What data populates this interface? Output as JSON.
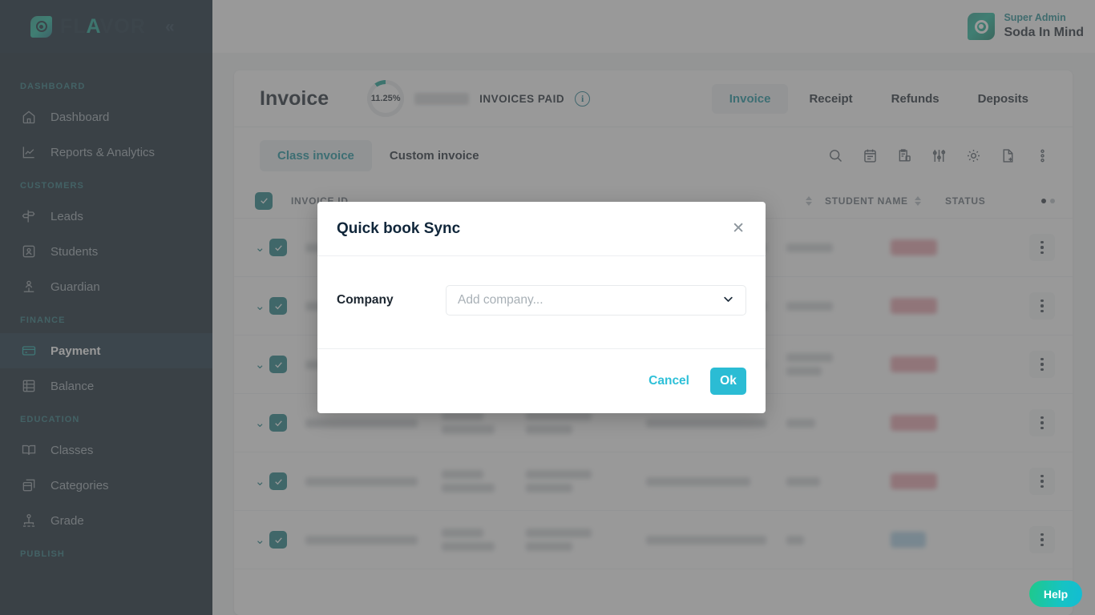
{
  "brand": {
    "logo_text_1": "FL",
    "logo_text_accent": "A",
    "logo_text_2": "VOR",
    "logo_icon": "flavor-logo-icon",
    "collapse_icon": "«",
    "accent_teal": "#11a18e",
    "accent_cyan": "#2bbcd4",
    "sidebar_bg": "#061826"
  },
  "topbar": {
    "role": "Super Admin",
    "name": "Soda In Mind"
  },
  "sidebar": {
    "sections": [
      {
        "label": "DASHBOARD",
        "items": [
          {
            "label": "Dashboard",
            "icon": "home-icon",
            "active": false
          },
          {
            "label": "Reports & Analytics",
            "icon": "chart-line-icon",
            "active": false
          }
        ]
      },
      {
        "label": "CUSTOMERS",
        "items": [
          {
            "label": "Leads",
            "icon": "signpost-icon",
            "active": false
          },
          {
            "label": "Students",
            "icon": "id-card-icon",
            "active": false
          },
          {
            "label": "Guardian",
            "icon": "guardian-icon",
            "active": false
          }
        ]
      },
      {
        "label": "FINANCE",
        "items": [
          {
            "label": "Payment",
            "icon": "credit-card-icon",
            "active": true
          },
          {
            "label": "Balance",
            "icon": "ledger-icon",
            "active": false
          }
        ]
      },
      {
        "label": "EDUCATION",
        "items": [
          {
            "label": "Classes",
            "icon": "book-open-icon",
            "active": false
          },
          {
            "label": "Categories",
            "icon": "box-stack-icon",
            "active": false
          },
          {
            "label": "Grade",
            "icon": "hierarchy-icon",
            "active": false
          }
        ]
      },
      {
        "label": "PUBLISH",
        "items": []
      }
    ]
  },
  "invoice_card": {
    "title": "Invoice",
    "paid_percent": "11.25%",
    "paid_percent_value": 11.25,
    "paid_label": "INVOICES PAID",
    "info_icon": "info-icon",
    "header_tabs": [
      {
        "label": "Invoice",
        "active": true
      },
      {
        "label": "Receipt",
        "active": false
      },
      {
        "label": "Refunds",
        "active": false
      },
      {
        "label": "Deposits",
        "active": false
      }
    ],
    "sub_tabs": [
      {
        "label": "Class invoice",
        "active": true
      },
      {
        "label": "Custom invoice",
        "active": false
      }
    ],
    "toolbar_icons": [
      "search-icon",
      "notepad-icon",
      "clipboard-export-icon",
      "sliders-filter-icon",
      "gear-icon",
      "document-add-icon",
      "more-vertical-icon"
    ],
    "table": {
      "columns": [
        {
          "label": "INVOICE ID",
          "sortable": false
        },
        {
          "label": "",
          "sortable": true
        },
        {
          "label": "STUDENT NAME",
          "sortable": true
        },
        {
          "label": "STATUS",
          "sortable": false
        }
      ],
      "header_dots": [
        "#2b343d",
        "#b9c0c6"
      ],
      "rows": [
        {
          "status_color": "red"
        },
        {
          "status_color": "red"
        },
        {
          "status_color": "red"
        },
        {
          "status_color": "red"
        },
        {
          "status_color": "red"
        },
        {
          "status_color": "blue"
        }
      ]
    }
  },
  "modal": {
    "title": "Quick book Sync",
    "close_icon": "close-icon",
    "company_label": "Company",
    "company_placeholder": "Add company...",
    "company_value": "",
    "chevron_icon": "chevron-down-icon",
    "cancel_label": "Cancel",
    "ok_label": "Ok"
  },
  "help": {
    "label": "Help"
  }
}
